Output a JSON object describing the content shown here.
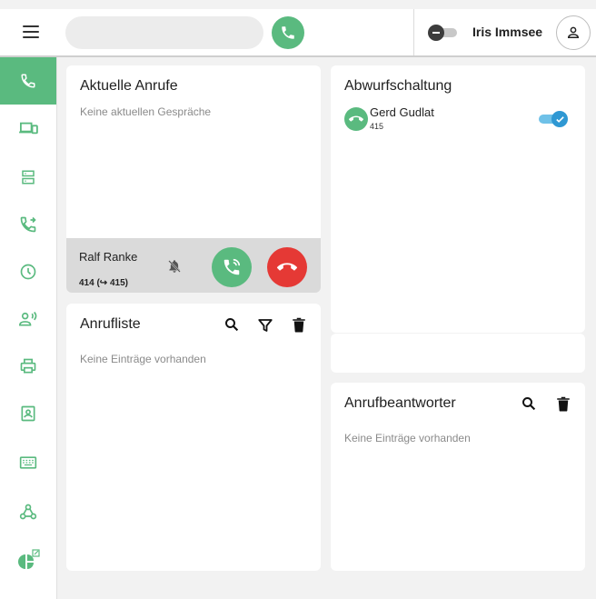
{
  "search": {
    "placeholder": "",
    "value": ""
  },
  "user": {
    "name": "Iris Immsee"
  },
  "active_calls": {
    "title": "Aktuelle Anrufe",
    "empty_text": "Keine aktuellen Gespräche",
    "incoming": {
      "name": "Ralf Ranke",
      "number": "414 (↪ 415)"
    }
  },
  "call_list": {
    "title": "Anrufliste",
    "empty_text": "Keine Einträge vorhanden"
  },
  "forwarding": {
    "title": "Abwurfschaltung",
    "contact": {
      "name": "Gerd Gudlat",
      "number": "415",
      "enabled": true
    }
  },
  "voicemail": {
    "title": "Anrufbeantworter",
    "empty_text": "Keine Einträge vorhanden"
  },
  "colors": {
    "accent": "#5aba7f",
    "danger": "#e53935",
    "toggle_on": "#2f98d3"
  },
  "sidebar": {
    "items": [
      {
        "icon": "phone-icon",
        "active": true
      },
      {
        "icon": "devices-icon"
      },
      {
        "icon": "server-icon"
      },
      {
        "icon": "phone-forward-icon"
      },
      {
        "icon": "clock-icon"
      },
      {
        "icon": "person-voice-icon"
      },
      {
        "icon": "printer-icon"
      },
      {
        "icon": "contact-book-icon"
      },
      {
        "icon": "keyboard-icon"
      },
      {
        "icon": "webhook-icon"
      },
      {
        "icon": "pie-chart-external-icon"
      }
    ]
  }
}
